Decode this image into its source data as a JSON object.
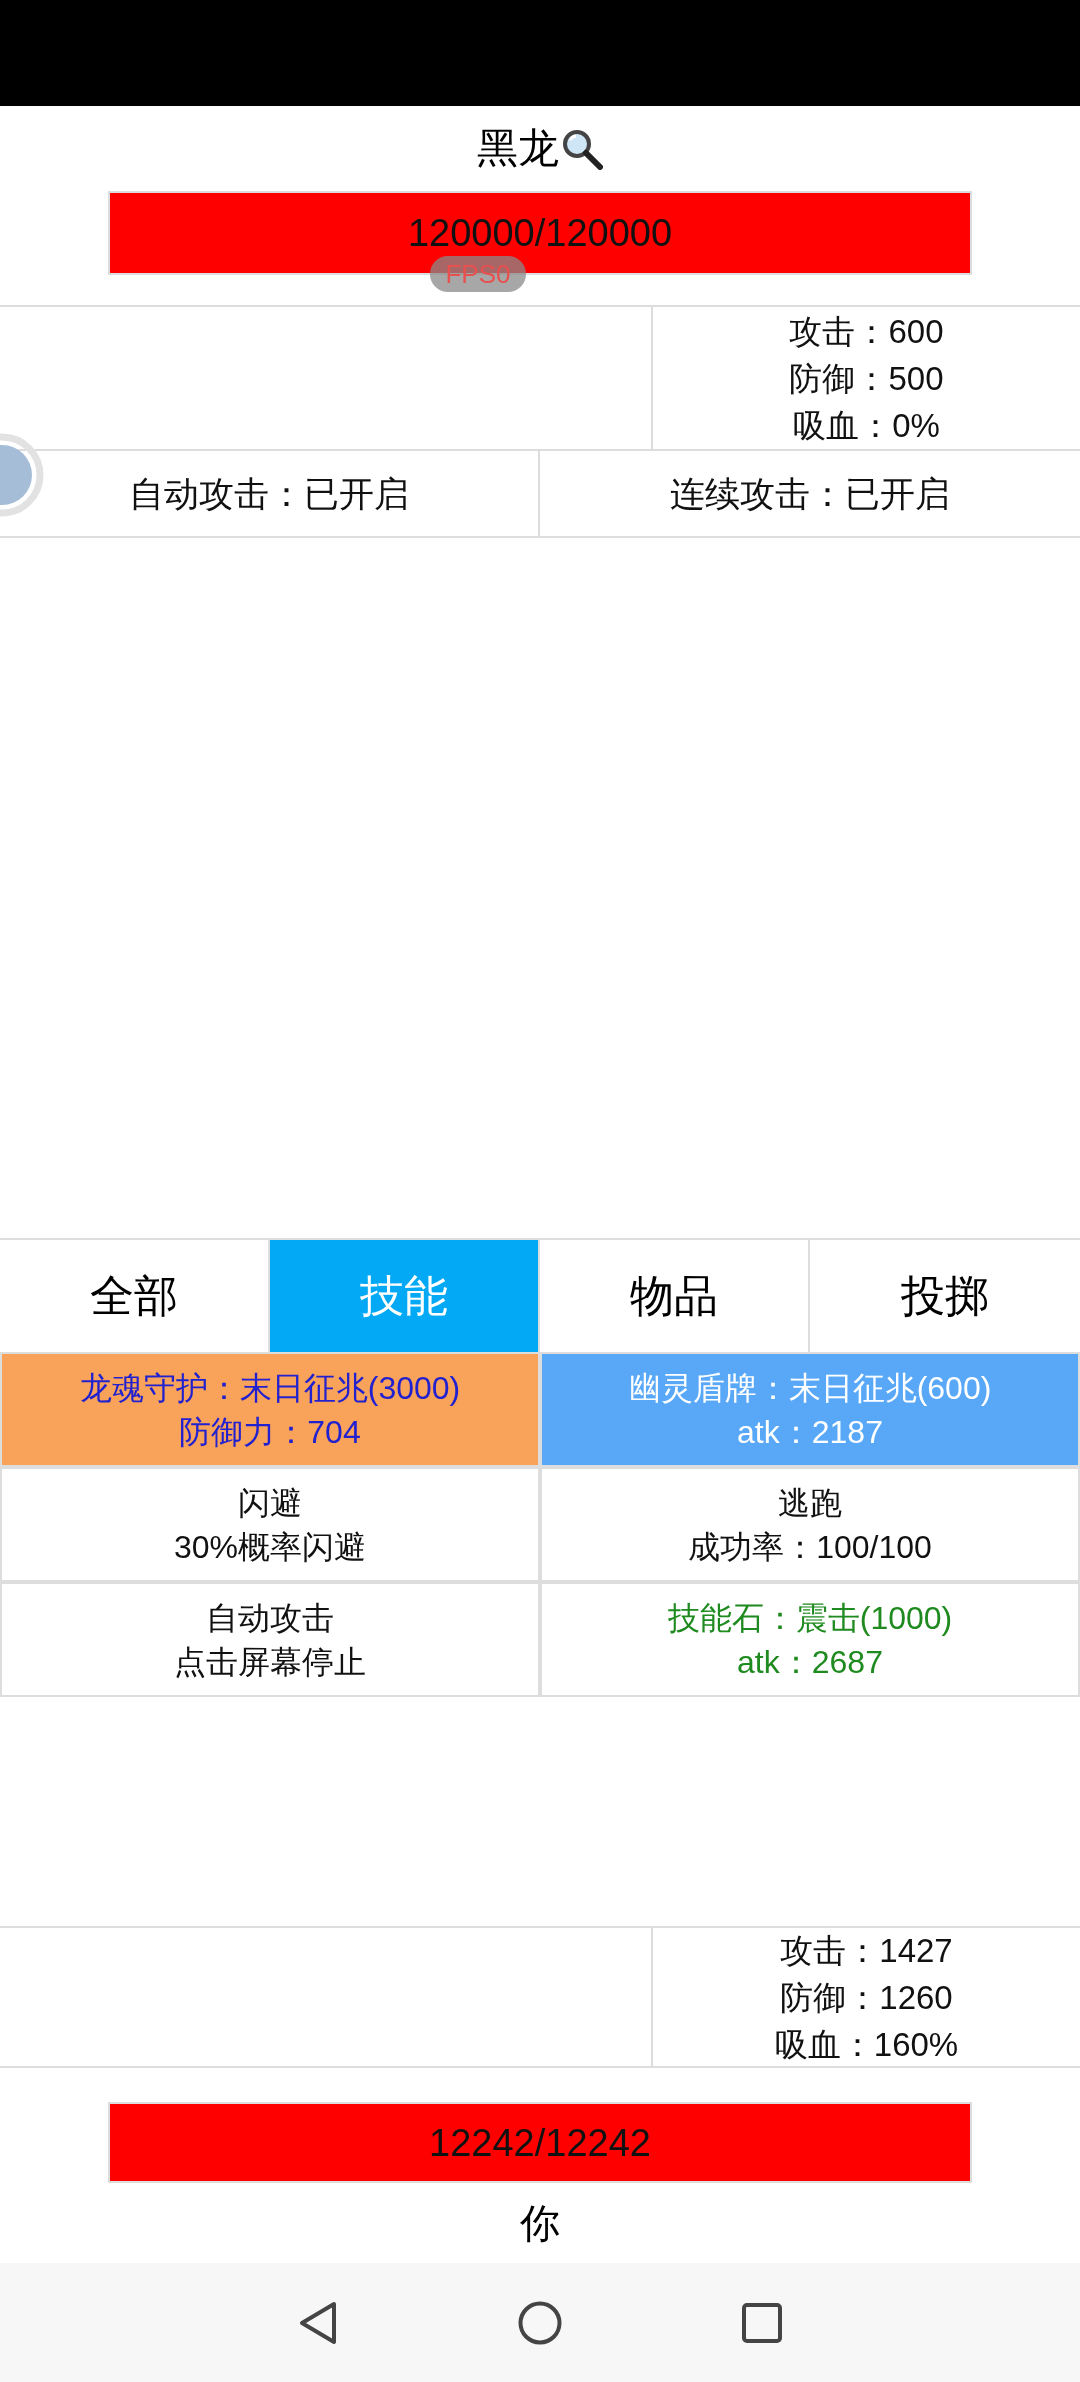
{
  "enemy": {
    "name": "黑龙",
    "hp": {
      "text": "120000/120000",
      "level": 1
    },
    "stats": [
      "攻击：600",
      "防御：500",
      "吸血：0%"
    ]
  },
  "fps_badge": "FPS0",
  "toggles": [
    "自动攻击：已开启",
    "连续攻击：已开启"
  ],
  "tabs": [
    {
      "label": "全部",
      "selected": false
    },
    {
      "label": "技能",
      "selected": true
    },
    {
      "label": "物品",
      "selected": false
    },
    {
      "label": "投掷",
      "selected": false
    }
  ],
  "actions": [
    {
      "text": {
        "lines": [
          "龙魂守护：末日征兆(3000)",
          "防御力：704"
        ],
        "color": "#2121cf"
      },
      "color": "#f9a25a"
    },
    {
      "text": {
        "lines": [
          "幽灵盾牌：末日征兆(600)",
          "atk：2187"
        ],
        "color": "#ffffff"
      },
      "color": "#58a8f7"
    },
    {
      "text": {
        "lines": [
          "闪避",
          "30%概率闪避"
        ],
        "color": "#111111"
      },
      "color": "#ffffff"
    },
    {
      "text": {
        "lines": [
          "逃跑",
          "成功率：100/100"
        ],
        "color": "#111111"
      },
      "color": "#ffffff"
    },
    {
      "text": {
        "lines": [
          "自动攻击",
          "点击屏幕停止"
        ],
        "color": "#111111"
      },
      "color": "#ffffff"
    },
    {
      "text": {
        "lines": [
          "技能石：震击(1000)",
          "atk：2687"
        ],
        "color": "#1f8a1f"
      },
      "color": "#ffffff"
    }
  ],
  "player": {
    "stats": [
      "攻击：1427",
      "防御：1260",
      "吸血：160%"
    ],
    "hp": {
      "text": "12242/12242",
      "level": 1
    },
    "name": "你"
  }
}
